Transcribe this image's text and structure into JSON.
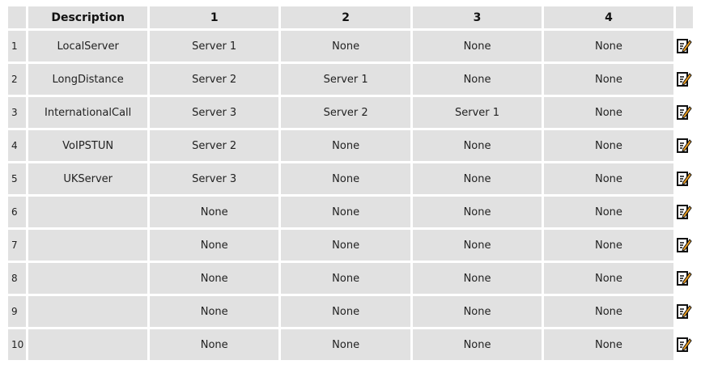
{
  "table": {
    "headers": [
      "",
      "Description",
      "1",
      "2",
      "3",
      "4",
      ""
    ],
    "rows": [
      {
        "num": "1",
        "desc": "LocalServer",
        "c1": "Server 1",
        "c2": "None",
        "c3": "None",
        "c4": "None"
      },
      {
        "num": "2",
        "desc": "LongDistance",
        "c1": "Server 2",
        "c2": "Server 1",
        "c3": "None",
        "c4": "None"
      },
      {
        "num": "3",
        "desc": "InternationalCall",
        "c1": "Server 3",
        "c2": "Server 2",
        "c3": "Server 1",
        "c4": "None"
      },
      {
        "num": "4",
        "desc": "VoIPSTUN",
        "c1": "Server 2",
        "c2": "None",
        "c3": "None",
        "c4": "None"
      },
      {
        "num": "5",
        "desc": "UKServer",
        "c1": "Server 3",
        "c2": "None",
        "c3": "None",
        "c4": "None"
      },
      {
        "num": "6",
        "desc": "",
        "c1": "None",
        "c2": "None",
        "c3": "None",
        "c4": "None"
      },
      {
        "num": "7",
        "desc": "",
        "c1": "None",
        "c2": "None",
        "c3": "None",
        "c4": "None"
      },
      {
        "num": "8",
        "desc": "",
        "c1": "None",
        "c2": "None",
        "c3": "None",
        "c4": "None"
      },
      {
        "num": "9",
        "desc": "",
        "c1": "None",
        "c2": "None",
        "c3": "None",
        "c4": "None"
      },
      {
        "num": "10",
        "desc": "",
        "c1": "None",
        "c2": "None",
        "c3": "None",
        "c4": "None"
      }
    ],
    "edit_icon": "edit-icon"
  },
  "colors": {
    "cell_bg": "#e1e1e1",
    "icon_accent": "#f0a020"
  }
}
